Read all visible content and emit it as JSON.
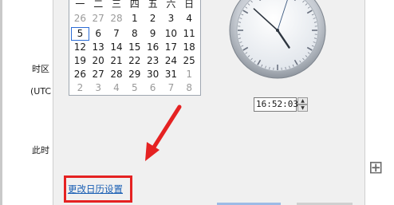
{
  "background_window": {
    "label_timezone": "时区",
    "label_utc": "(UTC",
    "label_time": "此时"
  },
  "calendar": {
    "weekdays": [
      "一",
      "二",
      "三",
      "四",
      "五",
      "六",
      "日"
    ],
    "weeks": [
      [
        "26",
        "27",
        "28",
        "1",
        "2",
        "3",
        "4"
      ],
      [
        "5",
        "6",
        "7",
        "8",
        "9",
        "10",
        "11"
      ],
      [
        "12",
        "13",
        "14",
        "15",
        "16",
        "17",
        "18"
      ],
      [
        "19",
        "20",
        "21",
        "22",
        "23",
        "24",
        "25"
      ],
      [
        "26",
        "27",
        "28",
        "29",
        "30",
        "31",
        "1"
      ],
      [
        "2",
        "3",
        "4",
        "5",
        "6",
        "7",
        "8"
      ]
    ],
    "selected_day": "5"
  },
  "clock": {
    "hour": 4,
    "minute": 52,
    "second": 3
  },
  "time_field": {
    "value": "16:52:03"
  },
  "link": {
    "label": "更改日历设置"
  },
  "colors": {
    "highlight": "#e52222",
    "link": "#1a5fb4",
    "selected_border": "#2b6cd6"
  }
}
